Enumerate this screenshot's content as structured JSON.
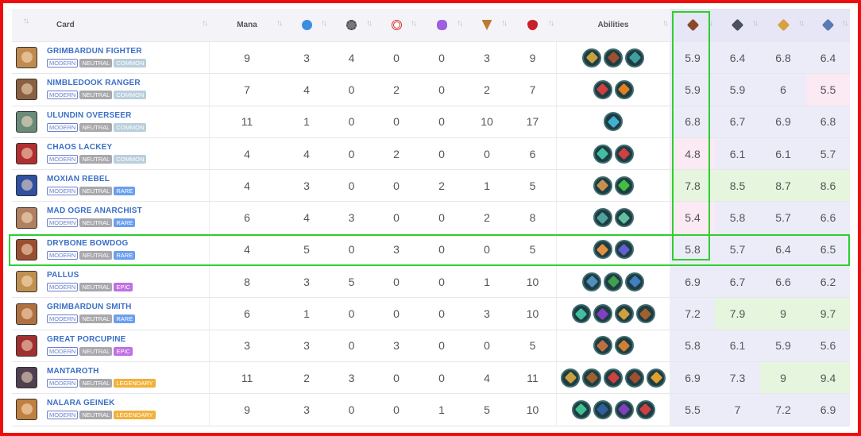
{
  "headers": {
    "card": "Card",
    "mana": "Mana",
    "abilities": "Abilities",
    "sort_icon": "sort-arrows-icon",
    "stat_icons": [
      "speed-icon",
      "melee-icon",
      "ranged-icon",
      "magic-icon",
      "armor-icon",
      "health-icon"
    ],
    "rate_icons": [
      "bronze-league-icon",
      "silver-league-icon",
      "gold-league-icon",
      "diamond-league-icon"
    ]
  },
  "colors": {
    "common": "#b9cfdc",
    "rare": "#6b9ff0",
    "epic": "#c070e2",
    "legendary": "#f2b13a",
    "highlight_box": "#2ecf2e",
    "frame": "#ee0d0d"
  },
  "rows": [
    {
      "name": "GRIMBARDUN FIGHTER",
      "edition": "MODERN",
      "element": "NEUTRAL",
      "rarity": "COMMON",
      "rarity_key": "common",
      "stats": [
        "9",
        "3",
        "4",
        "0",
        "0",
        "3",
        "9"
      ],
      "abilities": [
        "#c8a040",
        "#a05030",
        "#40a0a0"
      ],
      "rates": [
        "5.9",
        "6.4",
        "6.8",
        "6.4"
      ],
      "hl": [
        "",
        "",
        "",
        ""
      ],
      "thumb": "#c08a50"
    },
    {
      "name": "NIMBLEDOOK RANGER",
      "edition": "MODERN",
      "element": "NEUTRAL",
      "rarity": "COMMON",
      "rarity_key": "common",
      "stats": [
        "7",
        "4",
        "0",
        "2",
        "0",
        "2",
        "7"
      ],
      "abilities": [
        "#d04040",
        "#e08020"
      ],
      "rates": [
        "5.9",
        "5.9",
        "6",
        "5.5"
      ],
      "hl": [
        "",
        "",
        "",
        "pink"
      ],
      "thumb": "#8a6040"
    },
    {
      "name": "ULUNDIN OVERSEER",
      "edition": "MODERN",
      "element": "NEUTRAL",
      "rarity": "COMMON",
      "rarity_key": "common",
      "stats": [
        "11",
        "1",
        "0",
        "0",
        "0",
        "10",
        "17"
      ],
      "abilities": [
        "#40b0d0"
      ],
      "rates": [
        "6.8",
        "6.7",
        "6.9",
        "6.8"
      ],
      "hl": [
        "",
        "",
        "",
        ""
      ],
      "thumb": "#6a8a7a"
    },
    {
      "name": "CHAOS LACKEY",
      "edition": "MODERN",
      "element": "NEUTRAL",
      "rarity": "COMMON",
      "rarity_key": "common",
      "stats": [
        "4",
        "4",
        "0",
        "2",
        "0",
        "0",
        "6"
      ],
      "abilities": [
        "#40c0a0",
        "#d04040"
      ],
      "rates": [
        "4.8",
        "6.1",
        "6.1",
        "5.7"
      ],
      "hl": [
        "pink",
        "",
        "",
        ""
      ],
      "thumb": "#b03030"
    },
    {
      "name": "MOXIAN REBEL",
      "edition": "MODERN",
      "element": "NEUTRAL",
      "rarity": "RARE",
      "rarity_key": "rare",
      "stats": [
        "4",
        "3",
        "0",
        "0",
        "2",
        "1",
        "5"
      ],
      "abilities": [
        "#c89050",
        "#40c040"
      ],
      "rates": [
        "7.8",
        "8.5",
        "8.7",
        "8.6"
      ],
      "hl": [
        "green",
        "green",
        "green",
        "green"
      ],
      "thumb": "#3050a0"
    },
    {
      "name": "MAD OGRE ANARCHIST",
      "edition": "MODERN",
      "element": "NEUTRAL",
      "rarity": "RARE",
      "rarity_key": "rare",
      "stats": [
        "6",
        "4",
        "3",
        "0",
        "0",
        "2",
        "8"
      ],
      "abilities": [
        "#50a0a0",
        "#60c0a0"
      ],
      "rates": [
        "5.4",
        "5.8",
        "5.7",
        "6.6"
      ],
      "hl": [
        "pink",
        "",
        "",
        ""
      ],
      "thumb": "#b08060"
    },
    {
      "name": "DRYBONE BOWDOG",
      "edition": "MODERN",
      "element": "NEUTRAL",
      "rarity": "RARE",
      "rarity_key": "rare",
      "stats": [
        "4",
        "5",
        "0",
        "3",
        "0",
        "0",
        "5"
      ],
      "abilities": [
        "#e09040",
        "#6060d0"
      ],
      "rates": [
        "5.8",
        "5.7",
        "6.4",
        "6.5"
      ],
      "hl": [
        "",
        "",
        "",
        ""
      ],
      "thumb": "#9a5030"
    },
    {
      "name": "PALLUS",
      "edition": "MODERN",
      "element": "NEUTRAL",
      "rarity": "EPIC",
      "rarity_key": "epic",
      "stats": [
        "8",
        "3",
        "5",
        "0",
        "0",
        "1",
        "10"
      ],
      "abilities": [
        "#5090c0",
        "#40a050",
        "#4080c0"
      ],
      "rates": [
        "6.9",
        "6.7",
        "6.6",
        "6.2"
      ],
      "hl": [
        "",
        "",
        "",
        ""
      ],
      "thumb": "#c09050"
    },
    {
      "name": "GRIMBARDUN SMITH",
      "edition": "MODERN",
      "element": "NEUTRAL",
      "rarity": "RARE",
      "rarity_key": "rare",
      "stats": [
        "6",
        "1",
        "0",
        "0",
        "0",
        "3",
        "10"
      ],
      "abilities": [
        "#40c0a0",
        "#8040c0",
        "#d0a040",
        "#a06030"
      ],
      "rates": [
        "7.2",
        "7.9",
        "9",
        "9.7"
      ],
      "hl": [
        "",
        "green",
        "green",
        "green"
      ],
      "thumb": "#b07040"
    },
    {
      "name": "GREAT PORCUPINE",
      "edition": "MODERN",
      "element": "NEUTRAL",
      "rarity": "EPIC",
      "rarity_key": "epic",
      "stats": [
        "3",
        "3",
        "0",
        "3",
        "0",
        "0",
        "5"
      ],
      "abilities": [
        "#c07040",
        "#d08030"
      ],
      "rates": [
        "5.8",
        "6.1",
        "5.9",
        "5.6"
      ],
      "hl": [
        "",
        "",
        "",
        ""
      ],
      "thumb": "#a03030"
    },
    {
      "name": "MANTAROTH",
      "edition": "MODERN",
      "element": "NEUTRAL",
      "rarity": "LEGENDARY",
      "rarity_key": "legendary",
      "stats": [
        "11",
        "2",
        "3",
        "0",
        "0",
        "4",
        "11"
      ],
      "abilities": [
        "#c8a040",
        "#a06030",
        "#d04040",
        "#a05030",
        "#e0a030"
      ],
      "rates": [
        "6.9",
        "7.3",
        "9",
        "9.4"
      ],
      "hl": [
        "",
        "",
        "green",
        "green"
      ],
      "thumb": "#504050"
    },
    {
      "name": "NALARA GEINEK",
      "edition": "MODERN",
      "element": "NEUTRAL",
      "rarity": "LEGENDARY",
      "rarity_key": "legendary",
      "stats": [
        "9",
        "3",
        "0",
        "0",
        "1",
        "5",
        "10"
      ],
      "abilities": [
        "#40c090",
        "#3060a0",
        "#8040c0",
        "#d04040"
      ],
      "rates": [
        "5.5",
        "7",
        "7.2",
        "6.9"
      ],
      "hl": [
        "",
        "",
        "",
        ""
      ],
      "thumb": "#c08040"
    }
  ]
}
